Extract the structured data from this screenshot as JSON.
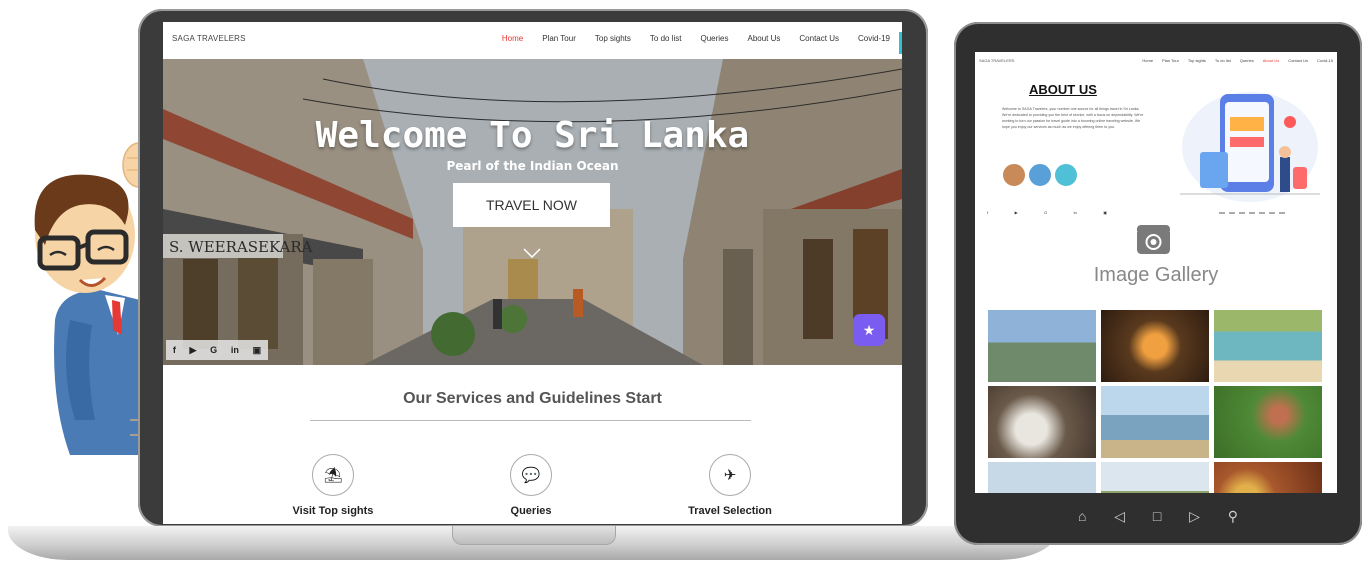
{
  "laptop": {
    "brand": "SAGA TRAVELERS",
    "nav": [
      {
        "label": "Home",
        "active": true
      },
      {
        "label": "Plan Tour",
        "active": false
      },
      {
        "label": "Top sights",
        "active": false
      },
      {
        "label": "To do list",
        "active": false
      },
      {
        "label": "Queries",
        "active": false
      },
      {
        "label": "About Us",
        "active": false
      },
      {
        "label": "Contact Us",
        "active": false
      },
      {
        "label": "Covid-19",
        "active": false
      }
    ],
    "hero": {
      "title": "Welcome To Sri Lanka",
      "subtitle": "Pearl of the Indian Ocean",
      "cta": "TRAVEL NOW",
      "social": [
        "f",
        "y",
        "G",
        "in",
        "☢"
      ]
    },
    "services": {
      "title": "Our Services and Guidelines Start",
      "items": [
        {
          "label": "Visit Top sights",
          "icon": "beach-umbrella-icon"
        },
        {
          "label": "Queries",
          "icon": "chat-icon"
        },
        {
          "label": "Travel Selection",
          "icon": "hiker-icon"
        }
      ]
    },
    "colors": {
      "active_nav": "#e53935",
      "fab": "#7b5cf0"
    }
  },
  "tablet": {
    "brand": "SAGA TRAVELERS",
    "nav": [
      {
        "label": "Home",
        "active": false
      },
      {
        "label": "Plan Tour",
        "active": false
      },
      {
        "label": "Top sights",
        "active": false
      },
      {
        "label": "To do list",
        "active": false
      },
      {
        "label": "Queries",
        "active": false
      },
      {
        "label": "About Us",
        "active": true
      },
      {
        "label": "Contact Us",
        "active": false
      },
      {
        "label": "Covid-19",
        "active": false
      }
    ],
    "about_title": "ABOUT US",
    "about_text": "Welcome to SAGA Travelers, your number one source for all things travel in Sri Lanka. We're dedicated to providing you the best of service, with a focus on dependability. We're working to turn our passion for travel guide into a booming online traveling website. We hope you enjoy our services as much as we enjoy offering them to you.",
    "social": [
      "f",
      "y",
      "G",
      "in",
      "☢"
    ],
    "gallery_title": "Image Gallery",
    "gallery": [
      {
        "name": "gallery-rock-fortress",
        "color": "#6f8a6a"
      },
      {
        "name": "gallery-fire-dance",
        "color": "#5a3a1e"
      },
      {
        "name": "gallery-beach",
        "color": "#6fb7c0"
      },
      {
        "name": "gallery-tea-cup",
        "color": "#6a5a4a"
      },
      {
        "name": "gallery-resort-pool",
        "color": "#7aa3c0"
      },
      {
        "name": "gallery-tea-plantation",
        "color": "#4f8a36"
      },
      {
        "name": "gallery-hills",
        "color": "#7f9b73"
      },
      {
        "name": "gallery-palm-trees",
        "color": "#8fa36b"
      },
      {
        "name": "gallery-food",
        "color": "#a8582c"
      }
    ]
  }
}
